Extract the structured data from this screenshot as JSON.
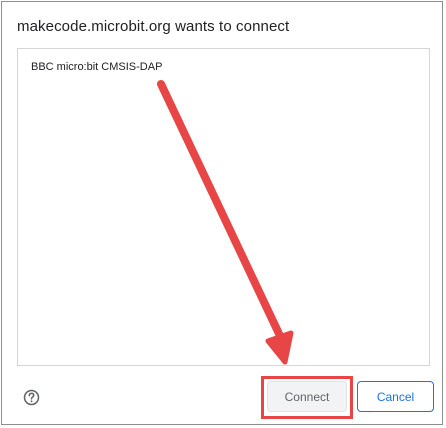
{
  "dialog": {
    "title": "makecode.microbit.org wants to connect",
    "devices": [
      {
        "label": "BBC micro:bit CMSIS-DAP"
      }
    ],
    "buttons": {
      "connect": "Connect",
      "cancel": "Cancel"
    },
    "help_icon": "question-circle-icon"
  },
  "annotation": {
    "arrow_color": "#e84646",
    "highlight_color": "#e84646",
    "points_to": "connect-button"
  },
  "colors": {
    "accent": "#1a73e8",
    "disabled_button_bg": "#f1f3f4"
  }
}
